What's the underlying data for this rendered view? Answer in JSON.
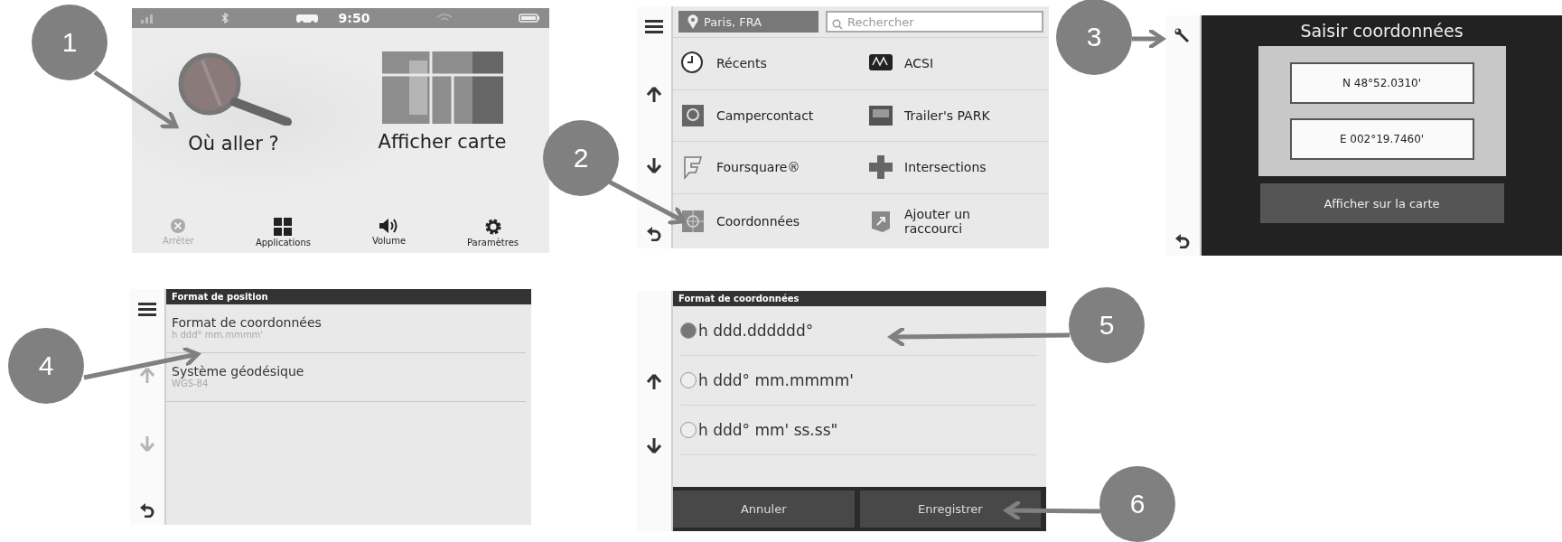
{
  "callouts": [
    {
      "number": "1"
    },
    {
      "number": "2"
    },
    {
      "number": "3"
    },
    {
      "number": "4"
    },
    {
      "number": "5"
    },
    {
      "number": "6"
    }
  ],
  "screen_home": {
    "status_bar": {
      "time": "9:50"
    },
    "tiles": [
      {
        "label": "Où aller ?",
        "kind": "search"
      },
      {
        "label": "Afficher carte",
        "kind": "map"
      }
    ],
    "toolbar": [
      {
        "label": "Arrêter",
        "kind": "stop",
        "disabled": true
      },
      {
        "label": "Applications",
        "kind": "apps",
        "disabled": false
      },
      {
        "label": "Volume",
        "kind": "volume",
        "disabled": false
      },
      {
        "label": "Paramètres",
        "kind": "settings",
        "disabled": false
      }
    ]
  },
  "screen_where_to": {
    "scroll_disabled": false,
    "location": "Paris, FRA",
    "search": {
      "placeholder": "Rechercher"
    },
    "items": [
      {
        "label": "Récents",
        "kind": "clock"
      },
      {
        "label": "ACSI",
        "kind": "camper"
      },
      {
        "label": "Campercontact",
        "kind": "badge"
      },
      {
        "label": "Trailer's PARK",
        "kind": "trailer"
      },
      {
        "label": "Foursquare®",
        "kind": "flag"
      },
      {
        "label": "Intersections",
        "kind": "crossing"
      },
      {
        "label": "Coordonnées",
        "kind": "target"
      },
      {
        "label": "Ajouter un raccourci",
        "kind": "shortcut"
      }
    ]
  },
  "screen_enter_coordinates": {
    "title": "Saisir coordonnées",
    "fields": [
      {
        "value": "N 48°52.0310'"
      },
      {
        "value": "E 002°19.7460'"
      }
    ],
    "button": "Afficher sur la carte"
  },
  "screen_position_format": {
    "scroll_disabled": true,
    "header": "Format de position",
    "items": [
      {
        "label": "Format de coordonnées",
        "value": "h ddd° mm.mmmm'"
      },
      {
        "label": "Système géodésique",
        "value": "WGS-84"
      }
    ]
  },
  "screen_coordinate_format": {
    "scroll_disabled": false,
    "header": "Format de coordonnées",
    "options": [
      {
        "label": "h ddd.dddddd°",
        "selected": true
      },
      {
        "label": "h ddd° mm.mmmm'",
        "selected": false
      },
      {
        "label": "h ddd° mm' ss.ss\"",
        "selected": false
      }
    ],
    "buttons": [
      "Annuler",
      "Enregistrer"
    ]
  }
}
